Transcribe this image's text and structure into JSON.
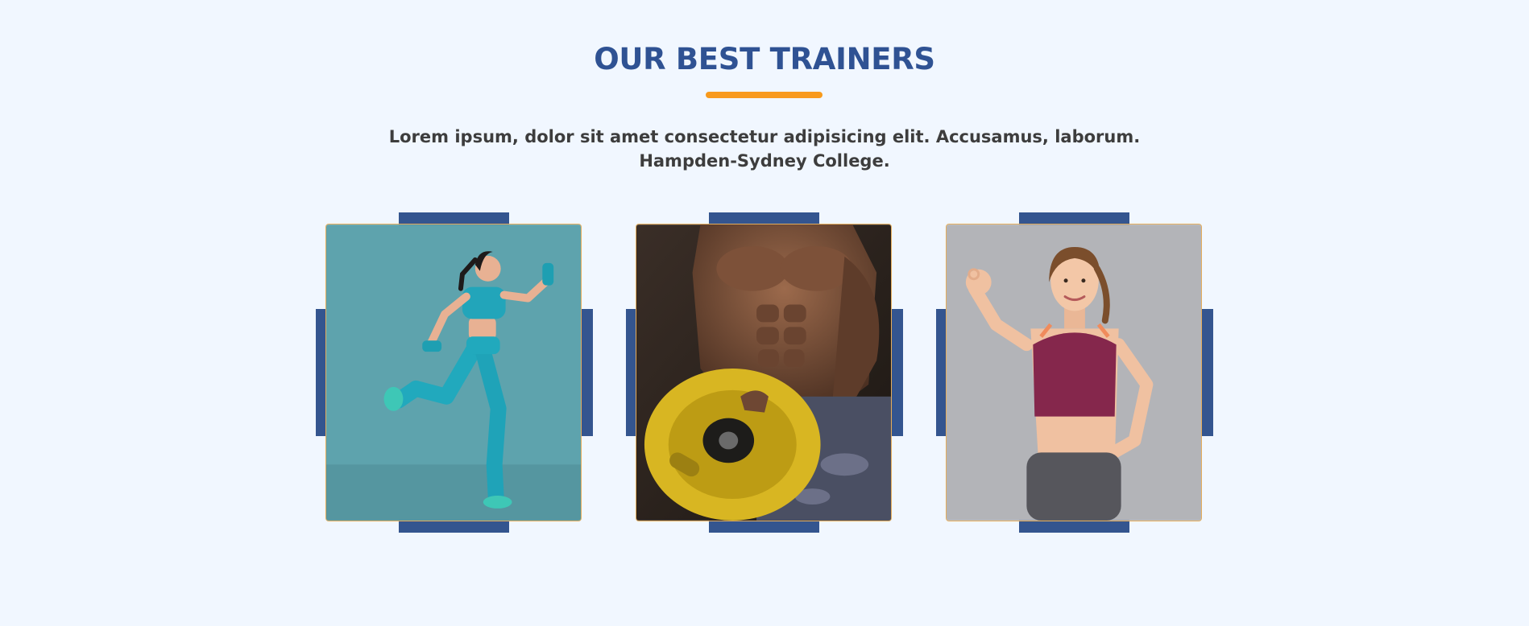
{
  "section": {
    "title": "OUR BEST TRAINERS",
    "description": "Lorem ipsum, dolor sit amet consectetur adipisicing elit. Accusamus, laborum. Hampden-Sydney College."
  },
  "trainers": [
    {
      "photo": "woman-running-with-dumbbells-photo",
      "background": "#5ea3ad"
    },
    {
      "photo": "muscular-man-holding-weight-plate-photo",
      "background": "#2d2621"
    },
    {
      "photo": "smiling-woman-ok-gesture-photo",
      "background": "#b3b4b8"
    }
  ],
  "colors": {
    "page_background": "#f1f7ff",
    "title": "#2f5293",
    "accent_underline": "#f89a1c",
    "text": "#3d3d3d",
    "decor_blocks": "#34558f",
    "frame_border": "#e5ad5b"
  }
}
